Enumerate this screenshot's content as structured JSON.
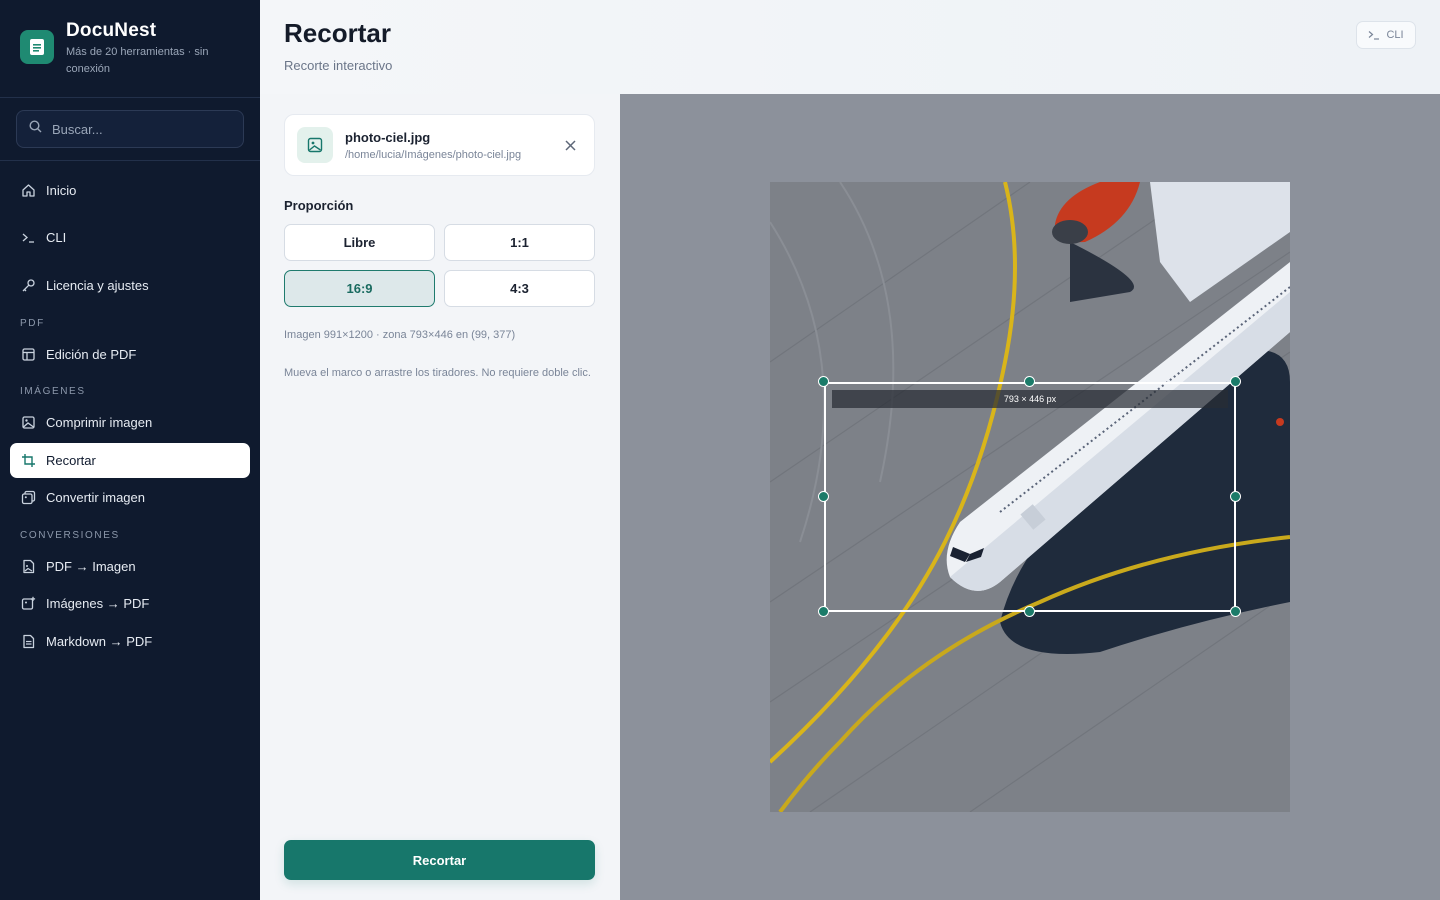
{
  "app": {
    "name": "DocuNest",
    "tagline": "Más de 20 herramientas · sin conexión"
  },
  "search": {
    "placeholder": "Buscar..."
  },
  "nav": {
    "inicio": "Inicio",
    "cli": "CLI",
    "licencia": "Licencia y ajustes",
    "section_pdf": "PDF",
    "edicion_pdf": "Edición de PDF",
    "section_imagenes": "IMÁGENES",
    "comprimir": "Comprimir imagen",
    "recortar": "Recortar",
    "convertir": "Convertir imagen",
    "section_conversiones": "CONVERSIONES",
    "pdf_imagen": "PDF → Imagen",
    "imagenes_pdf": "Imágenes → PDF",
    "markdown_pdf": "Markdown → PDF"
  },
  "header": {
    "title": "Recortar",
    "subtitle": "Recorte interactivo",
    "cli_label": "CLI"
  },
  "file": {
    "name": "photo-ciel.jpg",
    "path": "/home/lucia/Imágenes/photo-ciel.jpg"
  },
  "ratio": {
    "label": "Proporción",
    "options": [
      "Libre",
      "1:1",
      "16:9",
      "4:3"
    ],
    "selected": "16:9"
  },
  "info": "Imagen 991×1200 · zona 793×446 en (99, 377)",
  "hint": "Mueva el marco o arrastre los tiradores. No requiere doble clic.",
  "crop_size_label": "793 × 446 px",
  "action": {
    "crop_label": "Recortar"
  },
  "colors": {
    "accent": "#17776b",
    "sidebar": "#0f1a2e",
    "canvas": "#8c919b"
  }
}
